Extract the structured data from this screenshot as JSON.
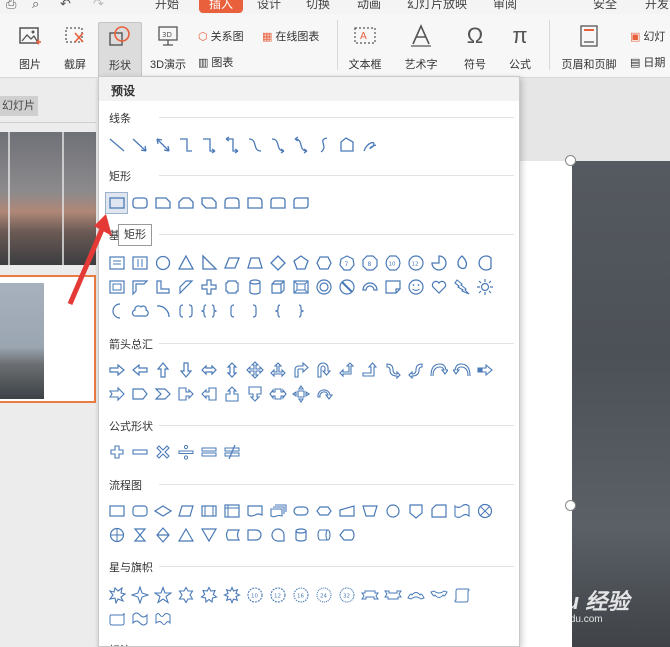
{
  "menubar": {
    "tabs": [
      "开始",
      "插入",
      "设计",
      "切换",
      "动画",
      "幻灯片放映",
      "审阅",
      "安全",
      "开发"
    ],
    "active_tab": "插入"
  },
  "ribbon": {
    "picture": "图片",
    "screenshot": "截屏",
    "shapes": "形状",
    "demo3d": "3D演示",
    "relation": "关系图",
    "online_chart": "在线图表",
    "chart": "图表",
    "textbox": "文本框",
    "wordart": "艺术字",
    "symbol": "符号",
    "formula": "公式",
    "header_footer": "页眉和页脚",
    "slide_cut": "幻灯",
    "date": "日期"
  },
  "panel": {
    "tab_label": "幻灯片"
  },
  "dropdown": {
    "header": "预设",
    "sections": {
      "lines": "线条",
      "rect": "矩形",
      "basic": "基",
      "arrows": "箭头总汇",
      "formula": "公式形状",
      "flowchart": "流程图",
      "stars": "星与旗帜",
      "callout": "标注"
    }
  },
  "tooltip": "矩形",
  "watermark": {
    "logo": "Baidu 经验",
    "url": "jingyan.baidu.com"
  },
  "colors": {
    "accent": "#e8603c",
    "shape_stroke": "#4a7ab7",
    "arrow": "#e53935"
  }
}
